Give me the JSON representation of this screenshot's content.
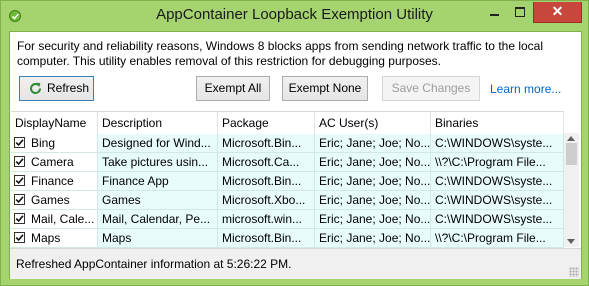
{
  "window": {
    "title": "AppContainer Loopback Exemption Utility",
    "close_glyph": "✕"
  },
  "message": "For security and reliability reasons, Windows 8 blocks apps from sending network traffic to the local computer. This utility enables removal of this restriction for debugging purposes.",
  "toolbar": {
    "refresh_label": "Refresh",
    "exempt_all_label": "Exempt All",
    "exempt_none_label": "Exempt None",
    "save_label": "Save Changes",
    "learn_more_label": "Learn more..."
  },
  "grid": {
    "columns": [
      "DisplayName",
      "Description",
      "Package",
      "AC User(s)",
      "Binaries"
    ],
    "rows": [
      {
        "checked": true,
        "name": "Bing",
        "description": "Designed for Wind...",
        "package": "Microsoft.Bin...",
        "users": "Eric; Jane; Joe; No...",
        "binaries": "C:\\WINDOWS\\syste..."
      },
      {
        "checked": true,
        "name": "Camera",
        "description": "Take pictures usin...",
        "package": "Microsoft.Ca...",
        "users": "Eric; Jane; Joe; No...",
        "binaries": "\\\\?\\C:\\Program File..."
      },
      {
        "checked": true,
        "name": "Finance",
        "description": "Finance App",
        "package": "Microsoft.Bin...",
        "users": "Eric; Jane; Joe; No...",
        "binaries": "C:\\WINDOWS\\syste..."
      },
      {
        "checked": true,
        "name": "Games",
        "description": "Games",
        "package": "Microsoft.Xbo...",
        "users": "Eric; Jane; Joe; No...",
        "binaries": "C:\\WINDOWS\\syste..."
      },
      {
        "checked": true,
        "name": "Mail, Cale...",
        "description": "Mail, Calendar, Pe...",
        "package": "microsoft.win...",
        "users": "Eric; Jane; Joe; No...",
        "binaries": "C:\\WINDOWS\\syste..."
      },
      {
        "checked": true,
        "name": "Maps",
        "description": "Maps",
        "package": "Microsoft.Bin...",
        "users": "Eric; Jane; Joe; No...",
        "binaries": "\\\\?\\C:\\Program File..."
      }
    ]
  },
  "status": {
    "text": "Refreshed AppContainer information at 5:26:22 PM."
  },
  "colors": {
    "frame": "#a5d36f",
    "close": "#c7473d",
    "row_shade": "#e7fbfb",
    "link": "#0066cc"
  },
  "icons": [
    "app-icon",
    "minimize-icon",
    "maximize-icon",
    "close-icon",
    "refresh-icon",
    "checkbox-checked-icon",
    "size-grip-icon"
  ]
}
